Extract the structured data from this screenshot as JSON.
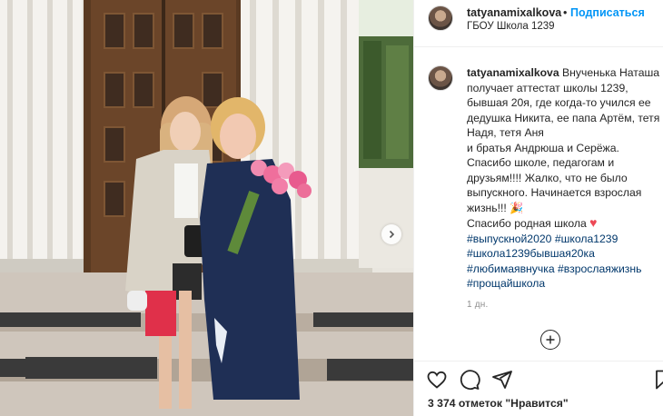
{
  "post": {
    "username": "tatyanamixalkova",
    "separator": "•",
    "follow_label": "Подписаться",
    "location": "ГБОУ Школа 1239"
  },
  "caption": {
    "username": "tatyanamixalkova",
    "lines": [
      "Внученька Наташа",
      "получает аттестат школы 1239,",
      "бывшая 20я, где когда-то учился ее",
      "дедушка Никита, ее папа Артём, тетя",
      "Надя, тетя Аня",
      "и братья Андрюша и Серёжа.",
      "Спасибо школе, педагогам и",
      "друзьям!!!! Жалко, что не было",
      "выпускного. Начинается взрослая",
      "жизнь!!!",
      "Спасибо родная школа"
    ],
    "emoji_popper": "🎉",
    "emoji_heart": "♥",
    "hashtags": {
      "t1": "#выпускной2020",
      "t2": "#школа1239",
      "t3": "#школа1239бывшая20ка",
      "t4": "#любимаявнучка",
      "t5": "#взрослаяжизнь",
      "t6": "#прощайшкола"
    },
    "time": "1 дн."
  },
  "likes": "3 374 отметок \"Нравится\"",
  "icons": {
    "like": "heart-icon",
    "comment": "comment-icon",
    "share": "paper-plane-icon",
    "save": "bookmark-icon",
    "more": "plus-circle-icon",
    "next": "chevron-right-icon"
  },
  "colors": {
    "link": "#00376b",
    "follow": "#0095f6",
    "heart": "#ed4956",
    "muted": "#8e8e8e"
  }
}
